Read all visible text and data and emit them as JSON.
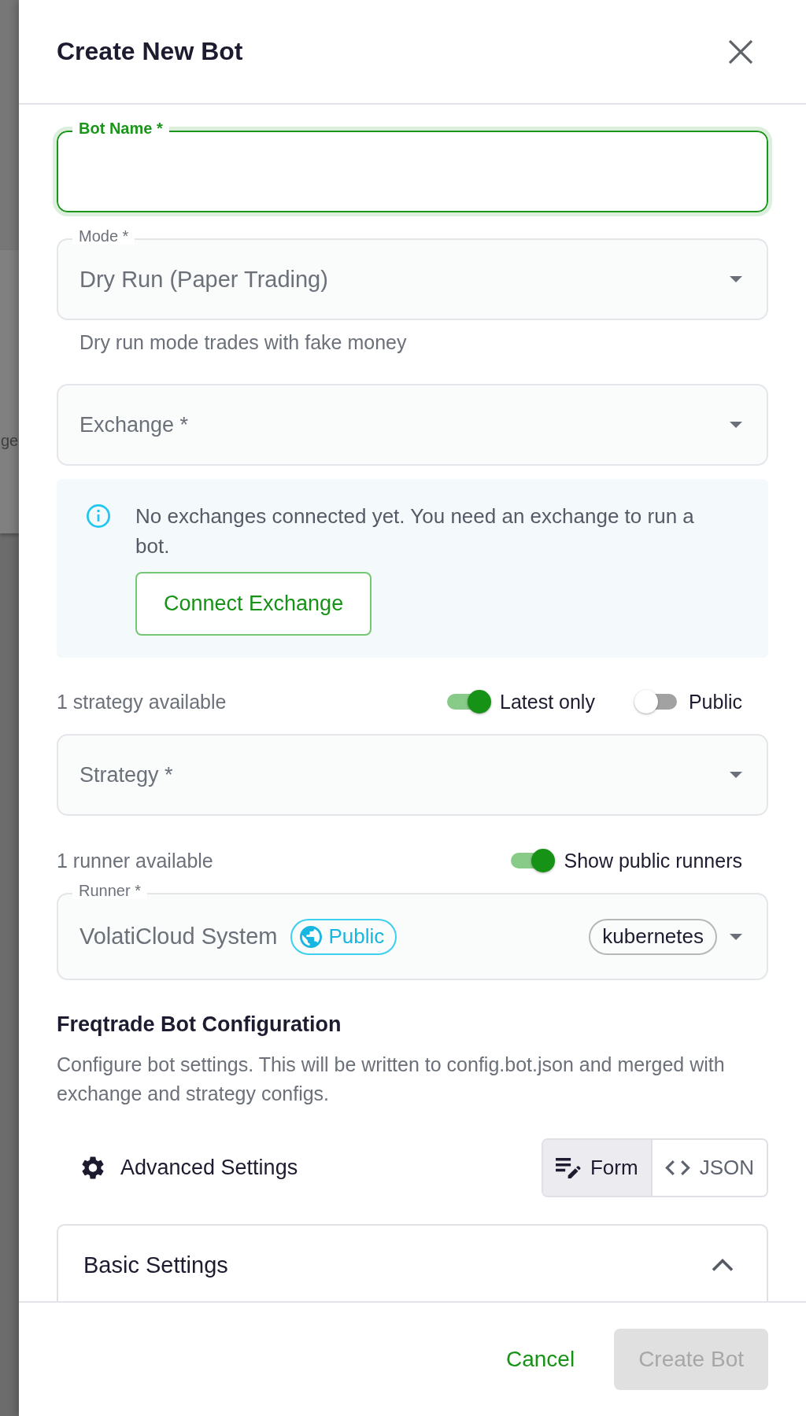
{
  "backdrop": {
    "text": "ge"
  },
  "header": {
    "title": "Create New Bot"
  },
  "bot_name": {
    "kind": "text",
    "label": "Bot Name *",
    "focused": true
  },
  "mode": {
    "kind": "select",
    "label": "Mode *",
    "value": "Dry Run (Paper Trading)",
    "hint": "Dry run mode trades with fake money"
  },
  "exchange": {
    "kind": "select",
    "label": "Exchange *"
  },
  "exchange_alert": {
    "message": "No exchanges connected yet. You need an exchange to run a bot.",
    "action": "Connect Exchange"
  },
  "strategy_filters": {
    "caption": "1 strategy available",
    "switches": [
      {
        "label": "Latest only",
        "on": true
      },
      {
        "label": "Public",
        "on": false
      }
    ]
  },
  "strategy": {
    "kind": "select",
    "label": "Strategy *"
  },
  "runner_filters": {
    "caption": "1 runner available",
    "switches": [
      {
        "label": "Show public runners",
        "on": true
      }
    ]
  },
  "runner": {
    "kind": "select",
    "label": "Runner *",
    "value": "VolatiCloud System",
    "badge": "Public",
    "chip": "kubernetes"
  },
  "bot_configuration": {
    "title": "Freqtrade Bot Configuration",
    "description": "Configure bot settings. This will be written to config.bot.json and merged with exchange and strategy configs.",
    "advanced_label": "Advanced Settings",
    "views": [
      {
        "label": "Form",
        "selected": true
      },
      {
        "label": "JSON",
        "selected": false
      }
    ]
  },
  "basic_settings": {
    "title": "Basic Settings",
    "expanded": true
  },
  "footer": {
    "buttons": [
      {
        "label": "Cancel",
        "kind": "secondary",
        "disabled": false
      },
      {
        "label": "Create Bot",
        "kind": "primary",
        "disabled": true
      }
    ]
  }
}
